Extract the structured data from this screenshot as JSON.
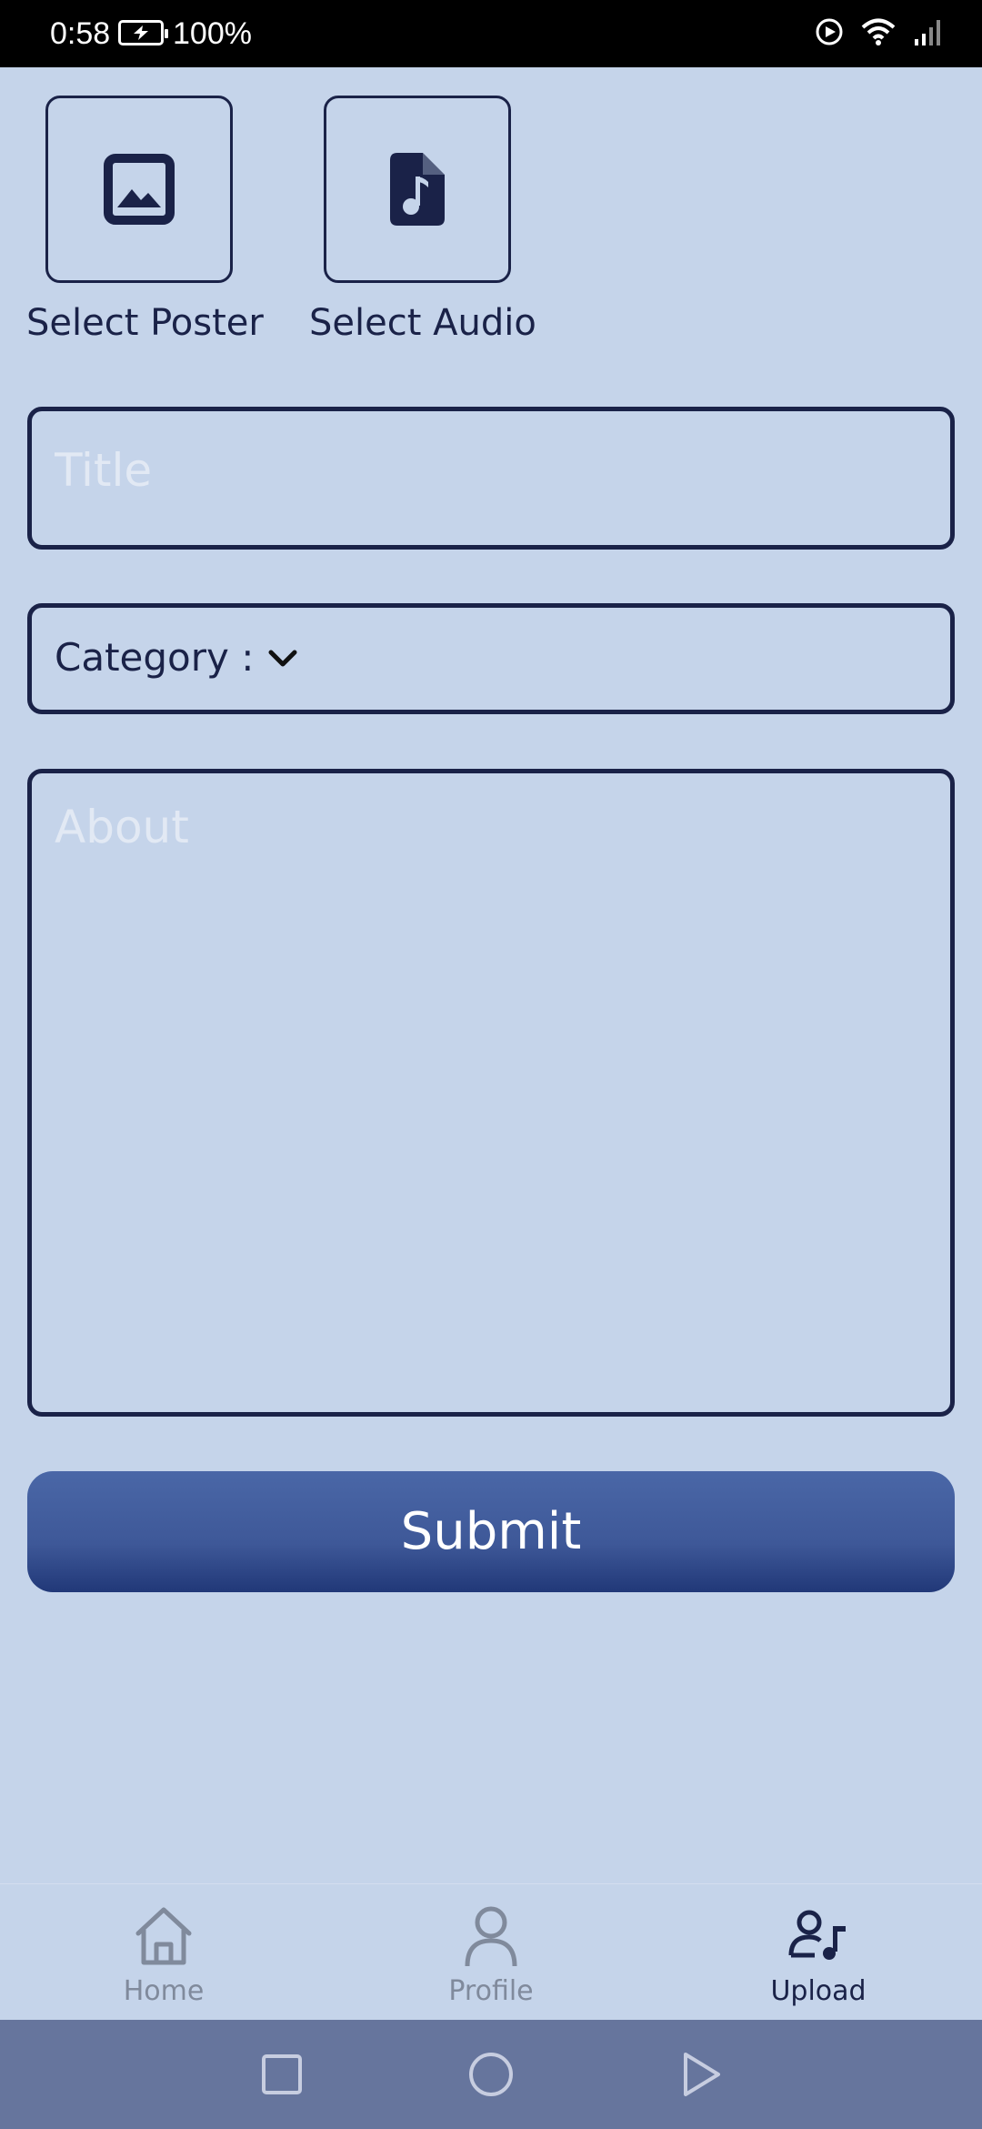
{
  "status_bar": {
    "time": "0:58",
    "battery": "100%"
  },
  "media": {
    "poster_label": "Select Poster",
    "audio_label": "Select Audio"
  },
  "form": {
    "title_placeholder": "Title",
    "category_label": "Category :",
    "about_placeholder": "About",
    "submit_label": "Submit"
  },
  "bottom_nav": {
    "items": [
      {
        "label": "Home",
        "icon": "home-icon",
        "active": false
      },
      {
        "label": "Profile",
        "icon": "person-icon",
        "active": false
      },
      {
        "label": "Upload",
        "icon": "upload-music-icon",
        "active": true
      }
    ]
  },
  "colors": {
    "background": "#c5d4ea",
    "primary_dark": "#1a2248",
    "button": "#3e5898",
    "system_nav": "#66759d"
  }
}
